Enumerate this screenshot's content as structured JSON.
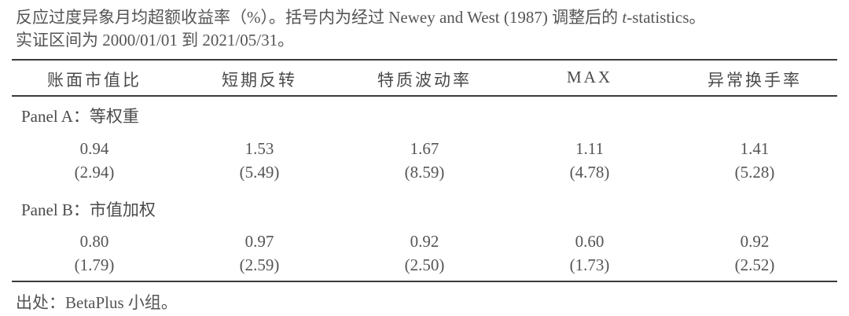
{
  "caption": {
    "line1_pre": "反应过度异象月均超额收益率（%）。括号内为经过 Newey and West (1987) 调整后的 ",
    "line1_ital": "t",
    "line1_post": "-statistics。",
    "line2": "实证区间为 2000/01/01 到 2021/05/31。"
  },
  "table": {
    "columns": [
      "账面市值比",
      "短期反转",
      "特质波动率",
      "MAX",
      "异常换手率"
    ],
    "panels": [
      {
        "label": "Panel A：等权重",
        "returns": [
          "0.94",
          "1.53",
          "1.67",
          "1.11",
          "1.41"
        ],
        "tstats": [
          "(2.94)",
          "(5.49)",
          "(8.59)",
          "(4.78)",
          "(5.28)"
        ]
      },
      {
        "label": "Panel B：市值加权",
        "returns": [
          "0.80",
          "0.97",
          "0.92",
          "0.60",
          "0.92"
        ],
        "tstats": [
          "(1.79)",
          "(2.59)",
          "(2.50)",
          "(1.73)",
          "(2.52)"
        ]
      }
    ]
  },
  "source": "出处：BetaPlus 小组。"
}
